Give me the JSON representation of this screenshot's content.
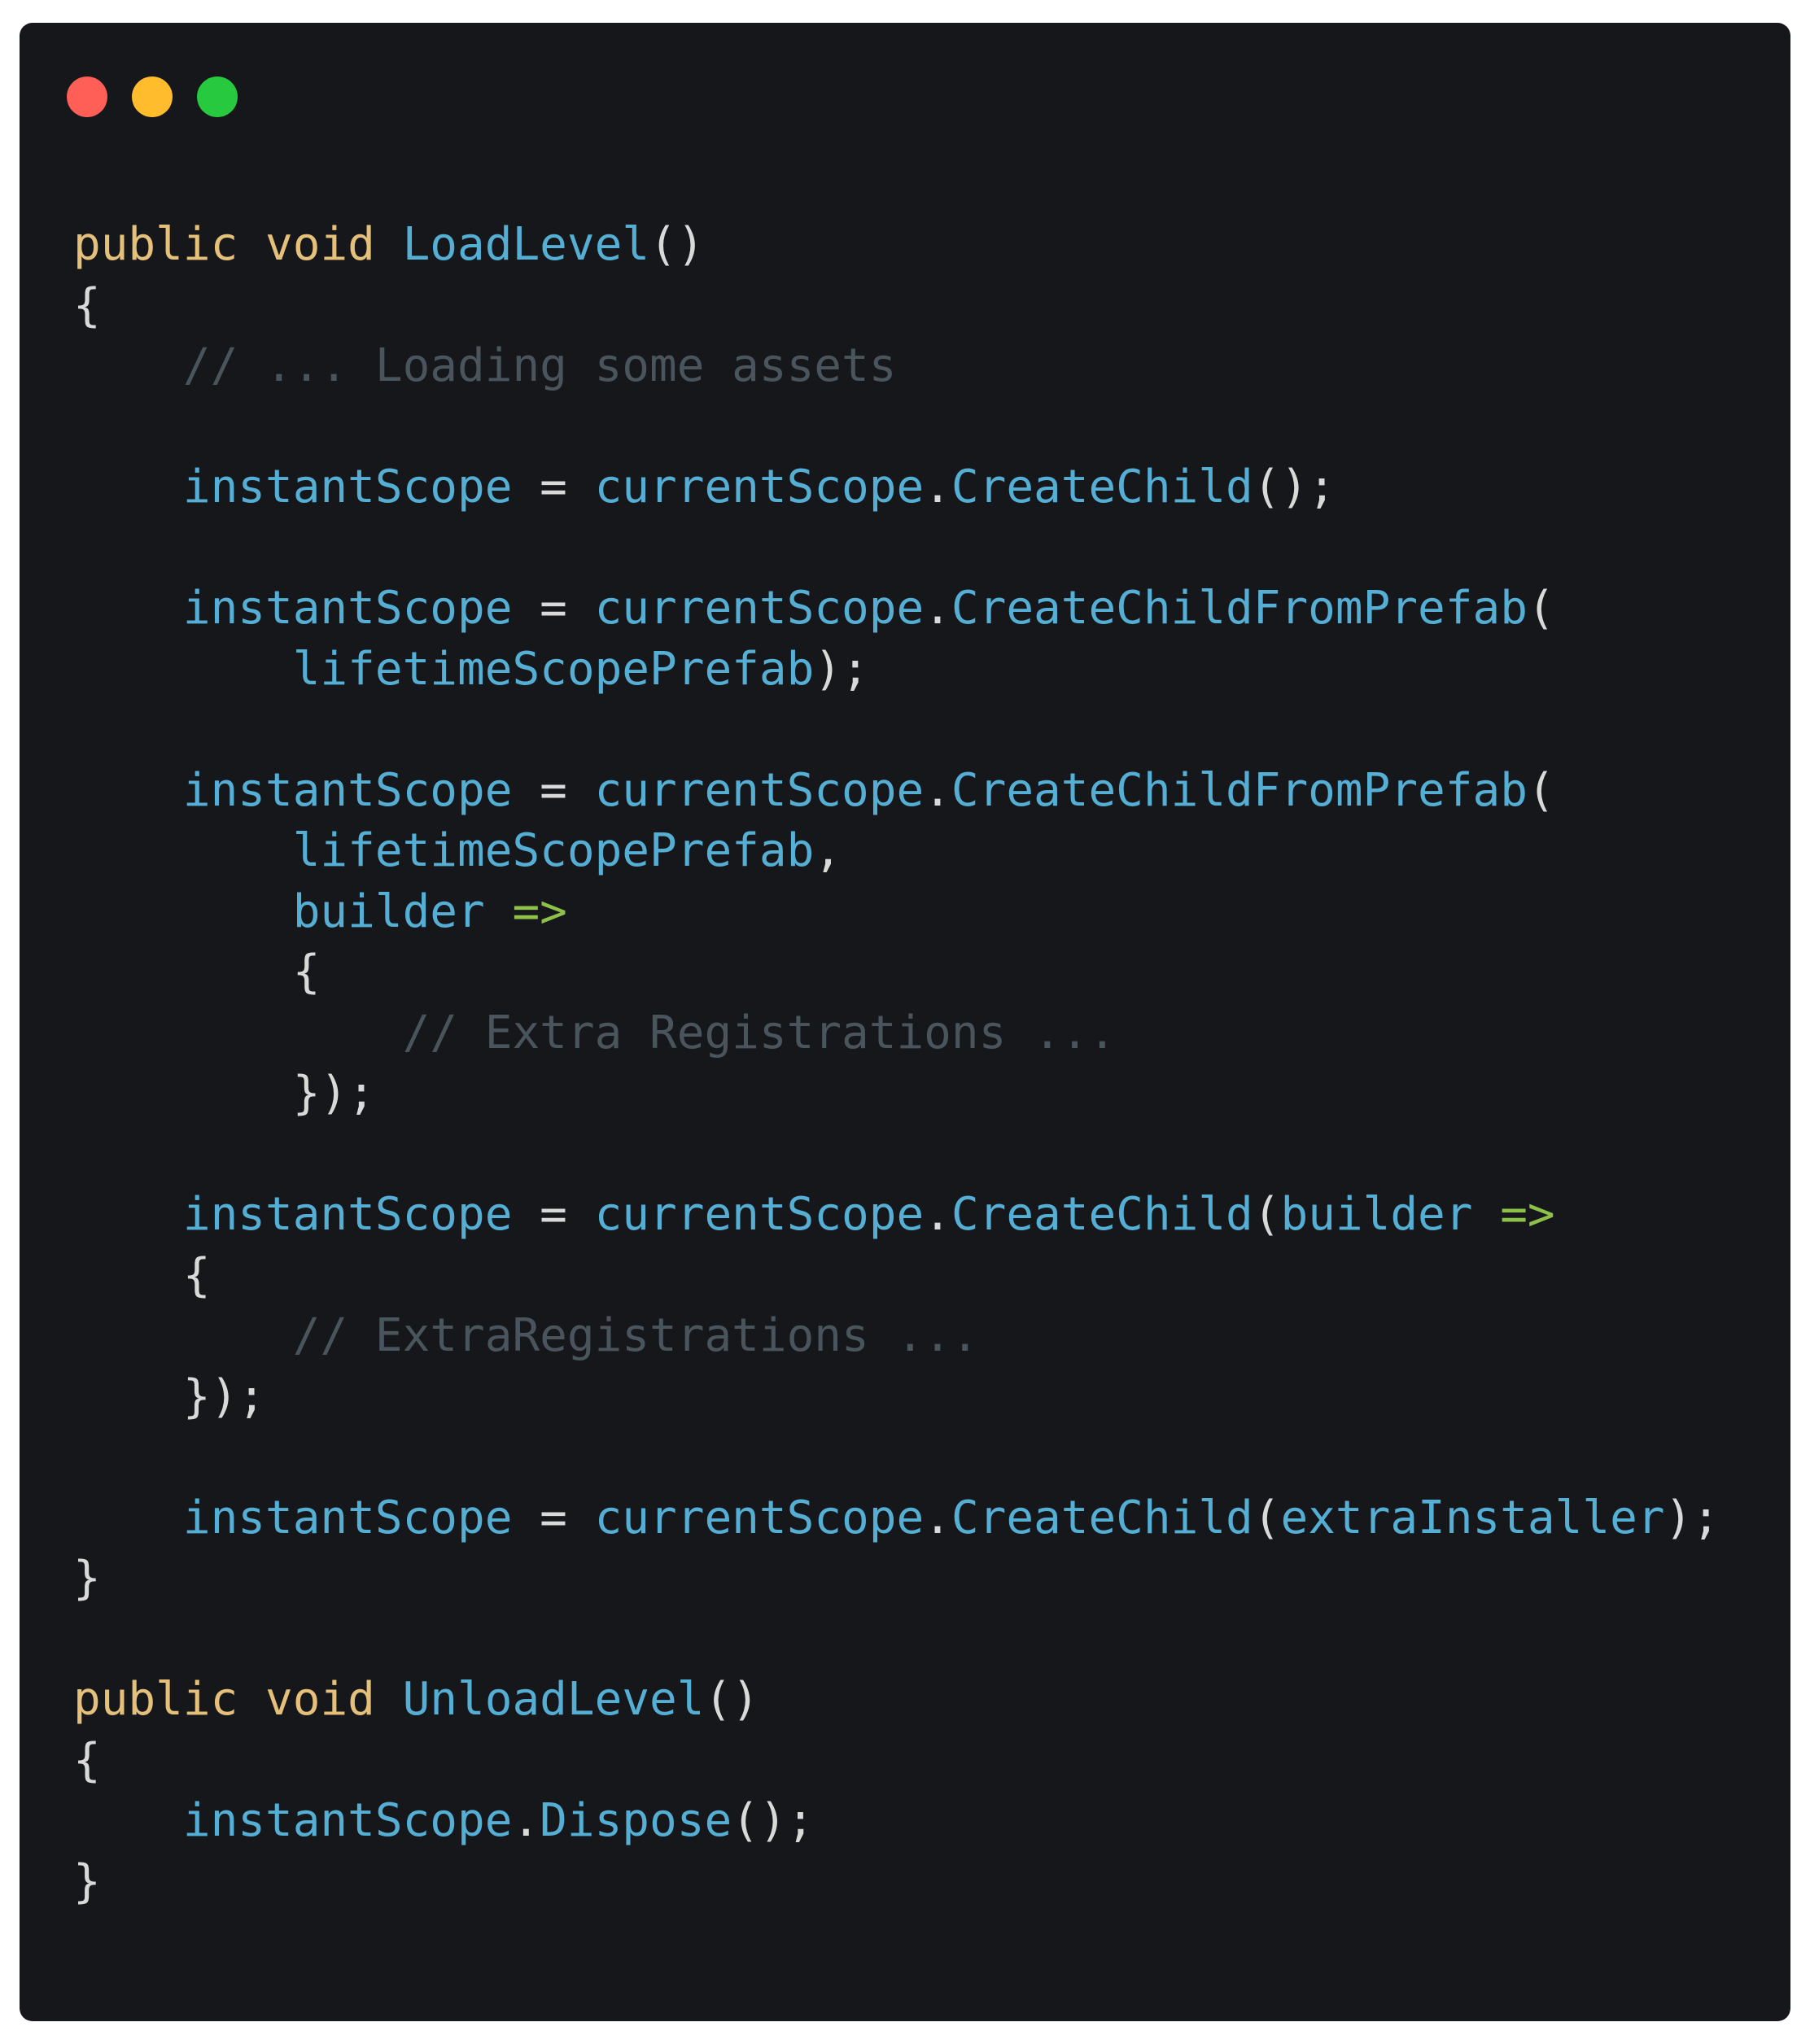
{
  "window": {
    "traffic_lights": [
      {
        "name": "close",
        "color": "#ff5f56"
      },
      {
        "name": "minimize",
        "color": "#ffbd2e"
      },
      {
        "name": "zoom",
        "color": "#27c93f"
      }
    ]
  },
  "theme": {
    "background": "#16171a",
    "keyword": "#e5c07b",
    "identifier": "#55aed4",
    "punctuation": "#d9d9d9",
    "arrow": "#8dc149",
    "comment": "#4a545d"
  },
  "code": {
    "language": "csharp",
    "lines": [
      [
        {
          "t": "keyword",
          "v": "public"
        },
        {
          "t": "text",
          "v": " "
        },
        {
          "t": "keyword",
          "v": "void"
        },
        {
          "t": "text",
          "v": " "
        },
        {
          "t": "function",
          "v": "LoadLevel"
        },
        {
          "t": "punct",
          "v": "()"
        }
      ],
      [
        {
          "t": "punct",
          "v": "{"
        }
      ],
      [
        {
          "t": "text",
          "v": "    "
        },
        {
          "t": "comment",
          "v": "// ... Loading some assets"
        }
      ],
      [],
      [
        {
          "t": "text",
          "v": "    "
        },
        {
          "t": "identifier",
          "v": "instantScope"
        },
        {
          "t": "text",
          "v": " "
        },
        {
          "t": "operator",
          "v": "="
        },
        {
          "t": "text",
          "v": " "
        },
        {
          "t": "identifier",
          "v": "currentScope"
        },
        {
          "t": "punct",
          "v": "."
        },
        {
          "t": "function",
          "v": "CreateChild"
        },
        {
          "t": "punct",
          "v": "();"
        }
      ],
      [],
      [
        {
          "t": "text",
          "v": "    "
        },
        {
          "t": "identifier",
          "v": "instantScope"
        },
        {
          "t": "text",
          "v": " "
        },
        {
          "t": "operator",
          "v": "="
        },
        {
          "t": "text",
          "v": " "
        },
        {
          "t": "identifier",
          "v": "currentScope"
        },
        {
          "t": "punct",
          "v": "."
        },
        {
          "t": "function",
          "v": "CreateChildFromPrefab"
        },
        {
          "t": "punct",
          "v": "("
        }
      ],
      [
        {
          "t": "text",
          "v": "        "
        },
        {
          "t": "identifier",
          "v": "lifetimeScopePrefab"
        },
        {
          "t": "punct",
          "v": ");"
        }
      ],
      [],
      [
        {
          "t": "text",
          "v": "    "
        },
        {
          "t": "identifier",
          "v": "instantScope"
        },
        {
          "t": "text",
          "v": " "
        },
        {
          "t": "operator",
          "v": "="
        },
        {
          "t": "text",
          "v": " "
        },
        {
          "t": "identifier",
          "v": "currentScope"
        },
        {
          "t": "punct",
          "v": "."
        },
        {
          "t": "function",
          "v": "CreateChildFromPrefab"
        },
        {
          "t": "punct",
          "v": "("
        }
      ],
      [
        {
          "t": "text",
          "v": "        "
        },
        {
          "t": "identifier",
          "v": "lifetimeScopePrefab"
        },
        {
          "t": "punct",
          "v": ","
        }
      ],
      [
        {
          "t": "text",
          "v": "        "
        },
        {
          "t": "identifier",
          "v": "builder"
        },
        {
          "t": "text",
          "v": " "
        },
        {
          "t": "arrow",
          "v": "=>"
        }
      ],
      [
        {
          "t": "text",
          "v": "        "
        },
        {
          "t": "punct",
          "v": "{"
        }
      ],
      [
        {
          "t": "text",
          "v": "            "
        },
        {
          "t": "comment",
          "v": "// Extra Registrations ..."
        }
      ],
      [
        {
          "t": "text",
          "v": "        "
        },
        {
          "t": "punct",
          "v": "});"
        }
      ],
      [],
      [
        {
          "t": "text",
          "v": "    "
        },
        {
          "t": "identifier",
          "v": "instantScope"
        },
        {
          "t": "text",
          "v": " "
        },
        {
          "t": "operator",
          "v": "="
        },
        {
          "t": "text",
          "v": " "
        },
        {
          "t": "identifier",
          "v": "currentScope"
        },
        {
          "t": "punct",
          "v": "."
        },
        {
          "t": "function",
          "v": "CreateChild"
        },
        {
          "t": "punct",
          "v": "("
        },
        {
          "t": "identifier",
          "v": "builder"
        },
        {
          "t": "text",
          "v": " "
        },
        {
          "t": "arrow",
          "v": "=>"
        }
      ],
      [
        {
          "t": "text",
          "v": "    "
        },
        {
          "t": "punct",
          "v": "{"
        }
      ],
      [
        {
          "t": "text",
          "v": "        "
        },
        {
          "t": "comment",
          "v": "// ExtraRegistrations ..."
        }
      ],
      [
        {
          "t": "text",
          "v": "    "
        },
        {
          "t": "punct",
          "v": "});"
        }
      ],
      [],
      [
        {
          "t": "text",
          "v": "    "
        },
        {
          "t": "identifier",
          "v": "instantScope"
        },
        {
          "t": "text",
          "v": " "
        },
        {
          "t": "operator",
          "v": "="
        },
        {
          "t": "text",
          "v": " "
        },
        {
          "t": "identifier",
          "v": "currentScope"
        },
        {
          "t": "punct",
          "v": "."
        },
        {
          "t": "function",
          "v": "CreateChild"
        },
        {
          "t": "punct",
          "v": "("
        },
        {
          "t": "identifier",
          "v": "extraInstaller"
        },
        {
          "t": "punct",
          "v": ");"
        }
      ],
      [
        {
          "t": "punct",
          "v": "}"
        }
      ],
      [],
      [
        {
          "t": "keyword",
          "v": "public"
        },
        {
          "t": "text",
          "v": " "
        },
        {
          "t": "keyword",
          "v": "void"
        },
        {
          "t": "text",
          "v": " "
        },
        {
          "t": "function",
          "v": "UnloadLevel"
        },
        {
          "t": "punct",
          "v": "()"
        }
      ],
      [
        {
          "t": "punct",
          "v": "{"
        }
      ],
      [
        {
          "t": "text",
          "v": "    "
        },
        {
          "t": "identifier",
          "v": "instantScope"
        },
        {
          "t": "punct",
          "v": "."
        },
        {
          "t": "function",
          "v": "Dispose"
        },
        {
          "t": "punct",
          "v": "();"
        }
      ],
      [
        {
          "t": "punct",
          "v": "}"
        }
      ]
    ]
  }
}
